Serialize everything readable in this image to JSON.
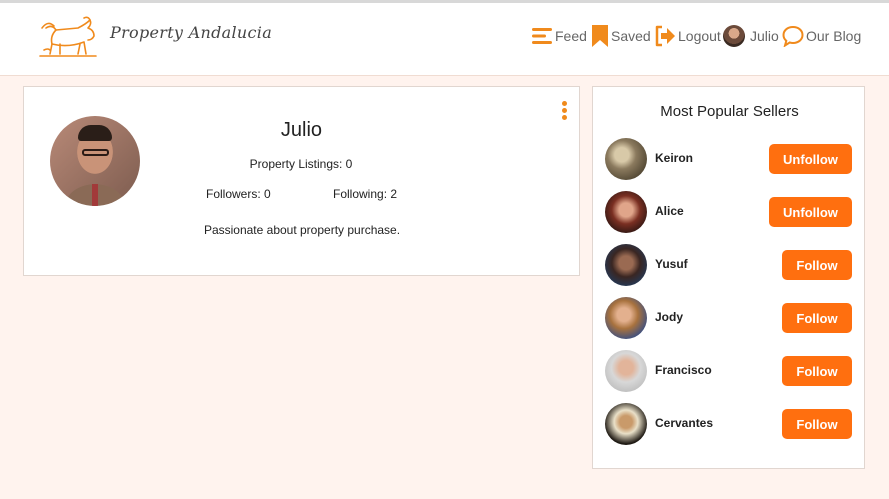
{
  "header": {
    "brand": "Property Andalucia",
    "nav": [
      {
        "label": "Feed",
        "icon": "menu-icon"
      },
      {
        "label": "Saved",
        "icon": "bookmark-icon"
      },
      {
        "label": "Logout",
        "icon": "logout-icon"
      },
      {
        "label": "Julio",
        "icon": "avatar"
      },
      {
        "label": "Our Blog",
        "icon": "chat-bubble-icon"
      }
    ]
  },
  "profile": {
    "name": "Julio",
    "listings": "Property Listings: 0",
    "followers": "Followers: 0",
    "following": "Following: 2",
    "bio": "Passionate about property purchase."
  },
  "sellers": {
    "title": "Most Popular Sellers",
    "items": [
      {
        "name": "Keiron",
        "action": "Unfollow"
      },
      {
        "name": "Alice",
        "action": "Unfollow"
      },
      {
        "name": "Yusuf",
        "action": "Follow"
      },
      {
        "name": "Jody",
        "action": "Follow"
      },
      {
        "name": "Francisco",
        "action": "Follow"
      },
      {
        "name": "Cervantes",
        "action": "Follow"
      }
    ]
  },
  "colors": {
    "accent": "#f08a1c",
    "button": "#ff6f0f",
    "background": "#fff3ee"
  }
}
